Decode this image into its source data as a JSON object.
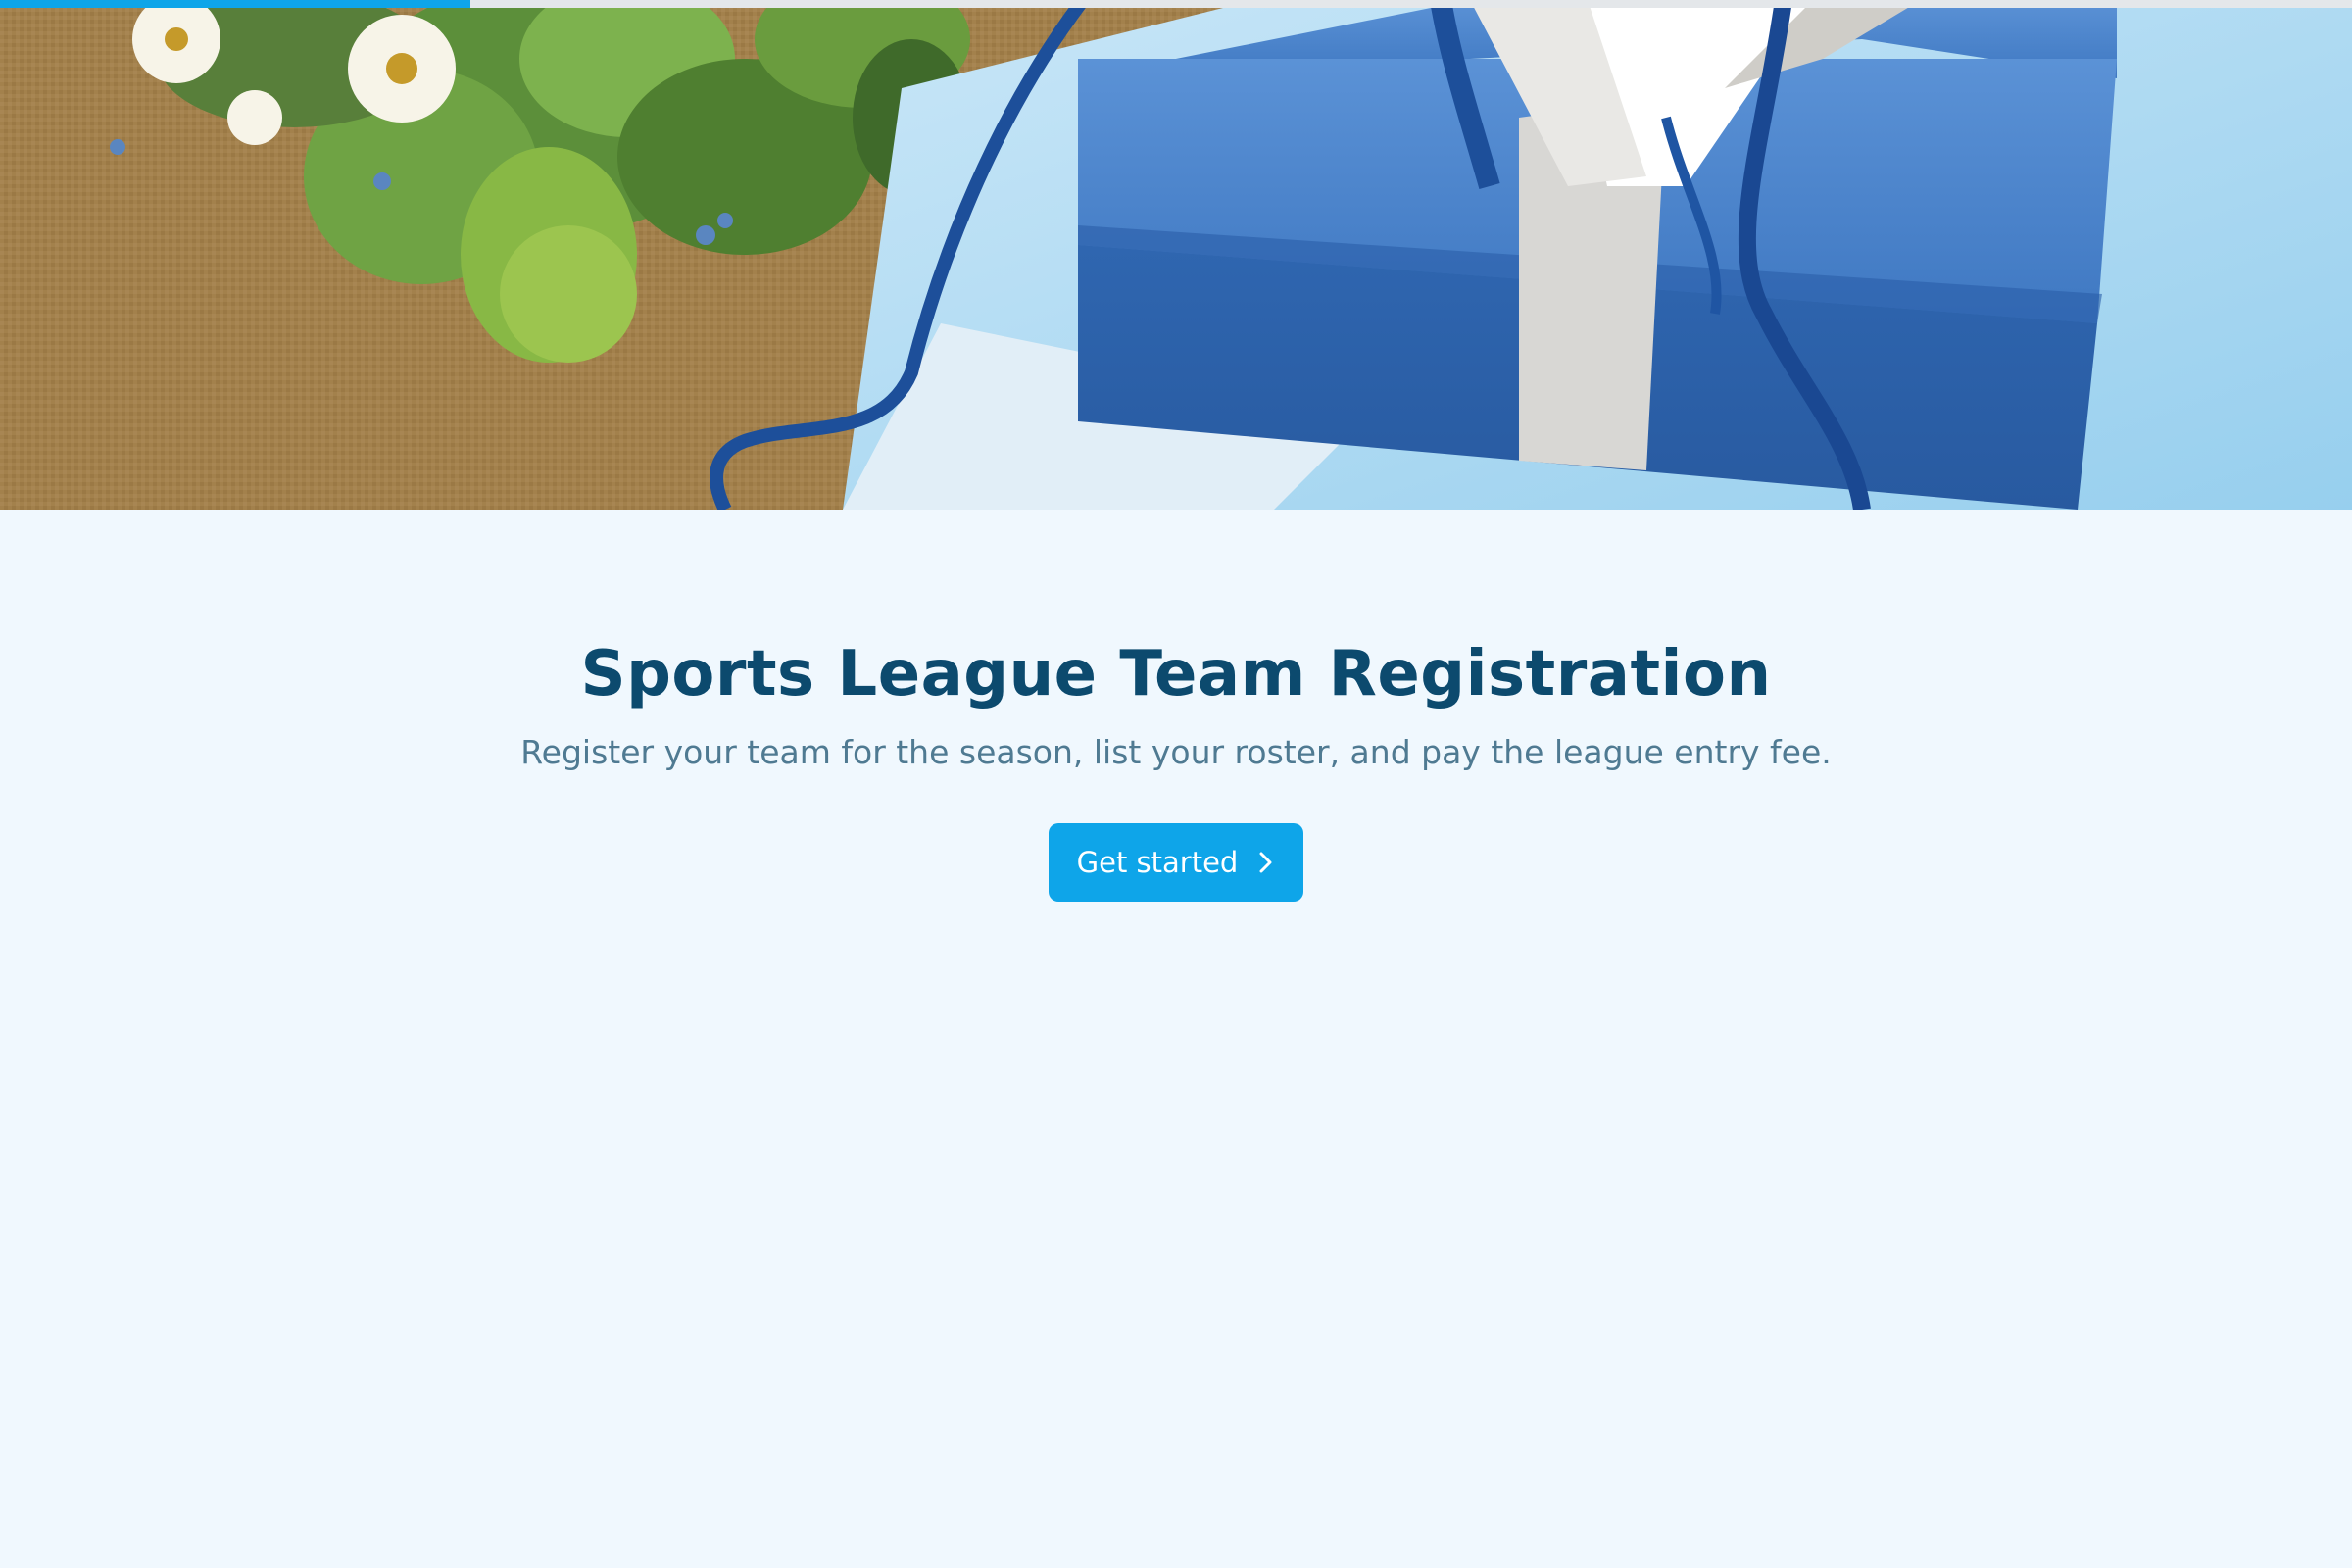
{
  "progress": {
    "fraction": 0.2
  },
  "hero": {
    "image": "gift-boxes-with-ribbon-and-flowers"
  },
  "page": {
    "title": "Sports League Team Registration",
    "subtitle": "Register your team for the season, list your roster, and pay the league entry fee.",
    "cta_label": "Get started",
    "cta_icon": "chevron-right-icon"
  },
  "colors": {
    "background": "#f0f8fe",
    "accent": "#0ea5e9",
    "title": "#0c4a6e",
    "subtitle": "#4f7a92"
  }
}
